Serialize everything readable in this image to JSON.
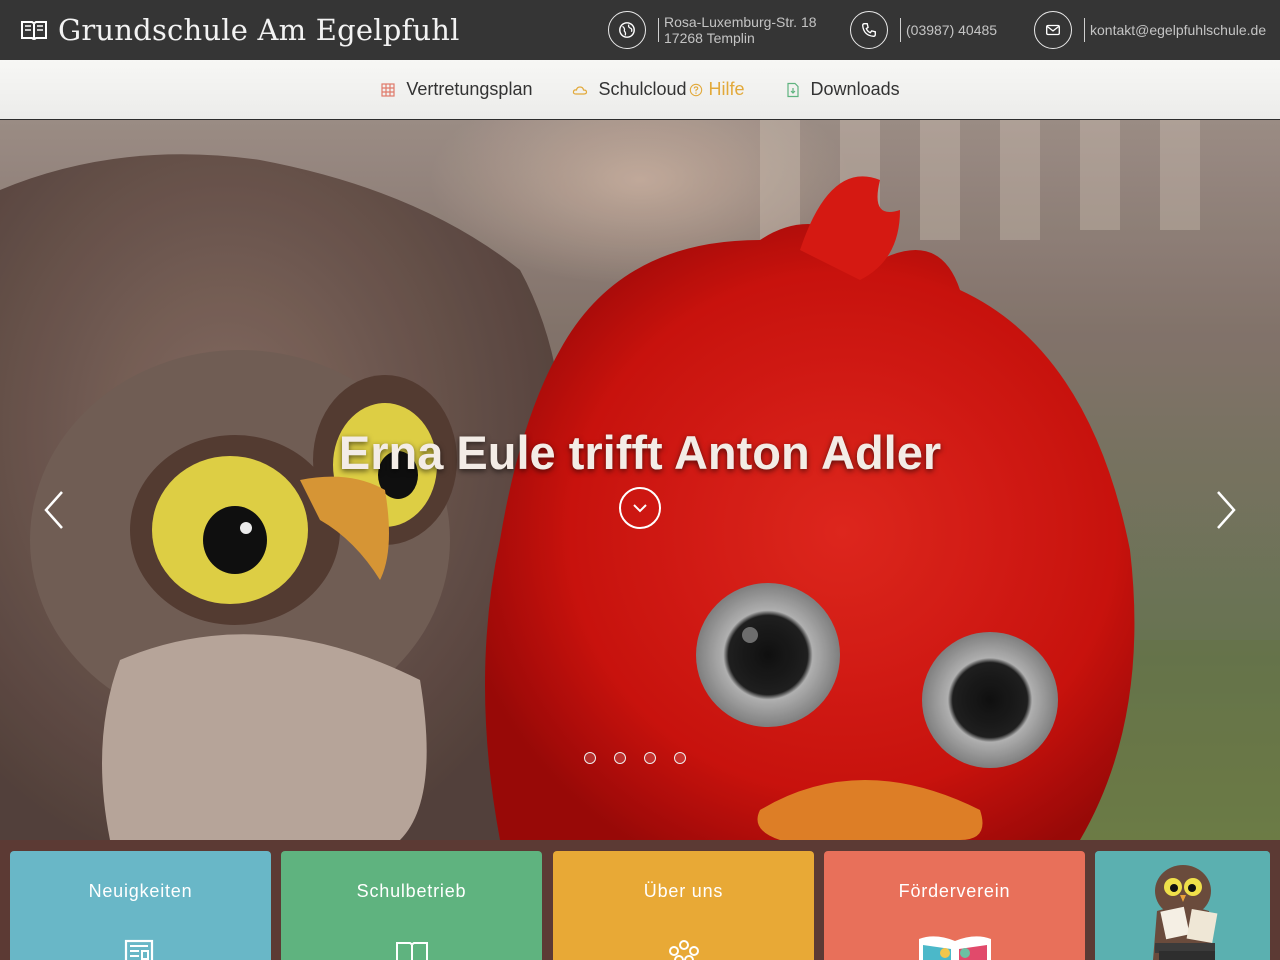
{
  "header": {
    "brand_title": "Grundschule Am Egelpfuhl",
    "address_line1": "Rosa-Luxemburg-Str. 18",
    "address_line2": "17268 Templin",
    "phone": "(03987) 40485",
    "email": "kontakt@egelpfuhlschule.de"
  },
  "nav": {
    "vertretungsplan": "Vertretungsplan",
    "schulcloud": "Schulcloud",
    "hilfe": "Hilfe",
    "downloads": "Downloads"
  },
  "hero": {
    "title": "Erna Eule trifft Anton Adler",
    "slide_count": 4
  },
  "tiles": [
    {
      "label": "Neuigkeiten",
      "color": "#69b7c7"
    },
    {
      "label": "Schulbetrieb",
      "color": "#5fb37f"
    },
    {
      "label": "Über uns",
      "color": "#e8a936"
    },
    {
      "label": "Förderverein",
      "color": "#e8705a"
    },
    {
      "label": "",
      "color": "#4fa3a8"
    }
  ],
  "colors": {
    "topbar": "#353535",
    "hilfe_accent": "#e2a93a",
    "vertretungsplan_icon": "#e07a6a",
    "schulcloud_icon": "#e2a93a",
    "downloads_icon": "#5fb37f"
  }
}
